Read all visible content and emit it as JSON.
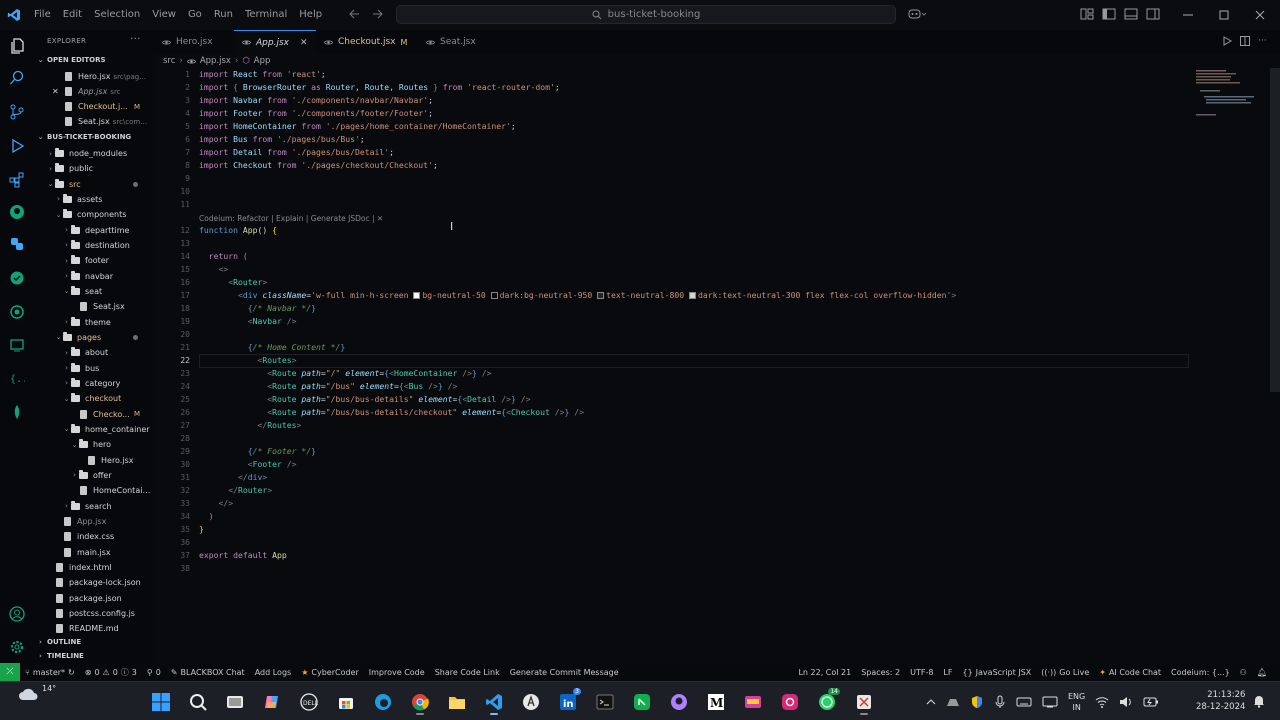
{
  "titlebar": {
    "menu": [
      "File",
      "Edit",
      "Selection",
      "View",
      "Go",
      "Run",
      "Terminal",
      "Help"
    ],
    "search_text": "bus-ticket-booking"
  },
  "sidebar": {
    "title": "EXPLORER",
    "open_editors_label": "OPEN EDITORS",
    "open_editors": [
      {
        "name": "Hero.jsx",
        "sub": "src\\pag...",
        "style": "norm"
      },
      {
        "name": "App.jsx",
        "sub": "src",
        "style": "ital"
      },
      {
        "name": "Checkout.j...",
        "badge": "M",
        "style": "mod"
      },
      {
        "name": "Seat.jsx",
        "sub": "src\\com...",
        "style": "norm"
      }
    ],
    "project_label": "BUS-TICKET-BOOKING",
    "tree": [
      {
        "name": "node_modules",
        "depth": 0,
        "type": "folder",
        "tw": "›"
      },
      {
        "name": "public",
        "depth": 0,
        "type": "folder",
        "tw": "›"
      },
      {
        "name": "src",
        "depth": 0,
        "type": "folder",
        "tw": "⌄",
        "mod": true,
        "dot": true
      },
      {
        "name": "assets",
        "depth": 1,
        "type": "folder",
        "tw": "›"
      },
      {
        "name": "components",
        "depth": 1,
        "type": "folder",
        "tw": "⌄"
      },
      {
        "name": "departtime",
        "depth": 2,
        "type": "folder",
        "tw": "›"
      },
      {
        "name": "destination",
        "depth": 2,
        "type": "folder",
        "tw": "›"
      },
      {
        "name": "footer",
        "depth": 2,
        "type": "folder",
        "tw": "›"
      },
      {
        "name": "navbar",
        "depth": 2,
        "type": "folder",
        "tw": "›"
      },
      {
        "name": "seat",
        "depth": 2,
        "type": "folder",
        "tw": "⌄"
      },
      {
        "name": "Seat.jsx",
        "depth": 3,
        "type": "file"
      },
      {
        "name": "theme",
        "depth": 2,
        "type": "folder",
        "tw": "›"
      },
      {
        "name": "pages",
        "depth": 1,
        "type": "folder",
        "tw": "⌄",
        "mod": true,
        "dot": true
      },
      {
        "name": "about",
        "depth": 2,
        "type": "folder",
        "tw": "›"
      },
      {
        "name": "bus",
        "depth": 2,
        "type": "folder",
        "tw": "›"
      },
      {
        "name": "category",
        "depth": 2,
        "type": "folder",
        "tw": "›"
      },
      {
        "name": "checkout",
        "depth": 2,
        "type": "folder",
        "tw": "⌄",
        "mod": true
      },
      {
        "name": "Checko...",
        "depth": 3,
        "type": "file",
        "mod": true,
        "badge": "M"
      },
      {
        "name": "home_container",
        "depth": 2,
        "type": "folder",
        "tw": "⌄"
      },
      {
        "name": "hero",
        "depth": 3,
        "type": "folder",
        "tw": "⌄"
      },
      {
        "name": "Hero.jsx",
        "depth": 4,
        "type": "file"
      },
      {
        "name": "offer",
        "depth": 3,
        "type": "folder",
        "tw": "›"
      },
      {
        "name": "HomeContain...",
        "depth": 3,
        "type": "file"
      },
      {
        "name": "search",
        "depth": 2,
        "type": "folder",
        "tw": "›"
      },
      {
        "name": "App.jsx",
        "depth": 1,
        "type": "file",
        "dim": true
      },
      {
        "name": "index.css",
        "depth": 1,
        "type": "file"
      },
      {
        "name": "main.jsx",
        "depth": 1,
        "type": "file"
      },
      {
        "name": "index.html",
        "depth": 0,
        "type": "file"
      },
      {
        "name": "package-lock.json",
        "depth": 0,
        "type": "file"
      },
      {
        "name": "package.json",
        "depth": 0,
        "type": "file"
      },
      {
        "name": "postcss.config.js",
        "depth": 0,
        "type": "file"
      },
      {
        "name": "README.md",
        "depth": 0,
        "type": "file"
      }
    ],
    "outline_label": "OUTLINE",
    "timeline_label": "TIMELINE"
  },
  "tabs": [
    {
      "label": "Hero.jsx",
      "active": false
    },
    {
      "label": "App.jsx",
      "active": true
    },
    {
      "label": "Checkout.jsx",
      "active": false,
      "badge": "M"
    },
    {
      "label": "Seat.jsx",
      "active": false
    }
  ],
  "breadcrumb": {
    "folder": "src",
    "file": "App.jsx",
    "symbol": "App"
  },
  "editor": {
    "codelens": "Codeium: Refactor | Explain | Generate JSDoc | ✕",
    "current_line": 22,
    "line_count": 38
  },
  "statusbar": {
    "branch": "master*",
    "errors": "0",
    "warnings": "0",
    "info": "3",
    "ports": "0",
    "items_left": [
      "BLACKBOX Chat",
      "Add Logs",
      "CyberCoder",
      "Improve Code",
      "Share Code Link",
      "Generate Commit Message"
    ],
    "cursor_pos": "Ln 22, Col 21",
    "spaces": "Spaces: 2",
    "encoding": "UTF-8",
    "eol": "LF",
    "language": "JavaScript JSX",
    "golive": "Go Live",
    "ai_chat": "AI Code Chat",
    "codeium": "Codeium: {...}"
  },
  "taskbar": {
    "temp": "14°",
    "lang_line1": "ENG",
    "lang_line2": "IN",
    "time": "21:13:26",
    "date": "28-12-2024",
    "badge_linkedin": "3",
    "badge_whatsapp": "14"
  },
  "colors": {
    "accent": "#3b8eea",
    "remote": "#16a34a",
    "modified": "#e2c08d"
  }
}
